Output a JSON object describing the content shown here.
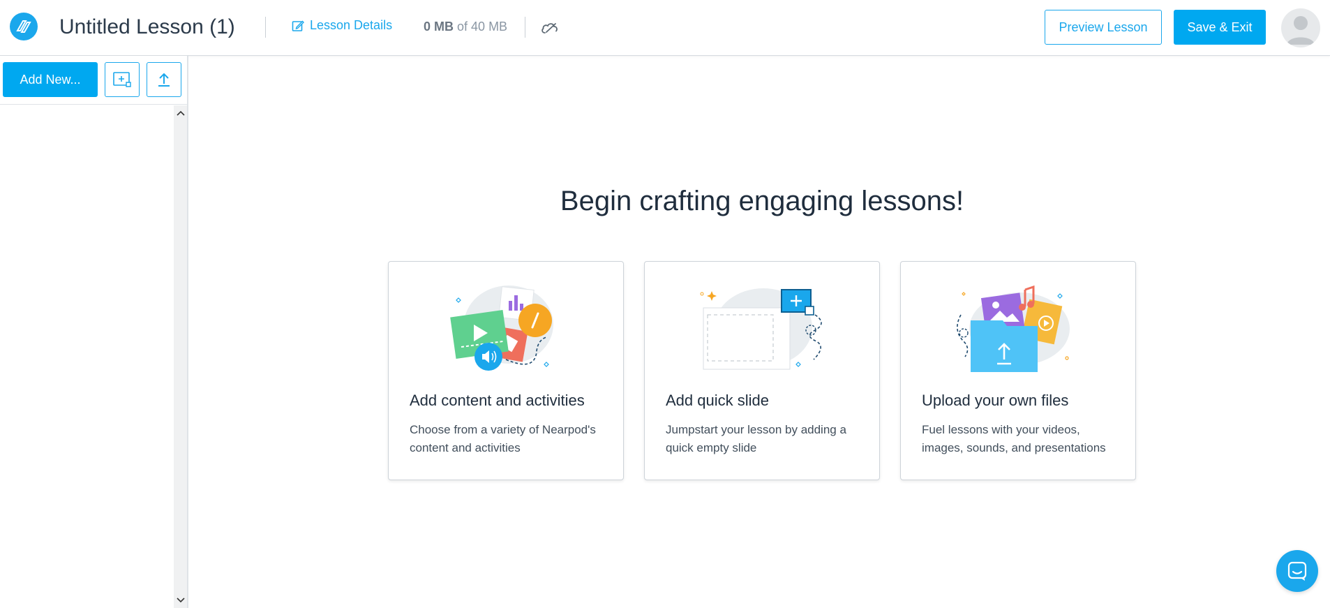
{
  "header": {
    "lesson_title": "Untitled Lesson (1)",
    "lesson_details_label": "Lesson Details",
    "storage_used": "0 MB",
    "storage_total": "of 40 MB",
    "preview_label": "Preview Lesson",
    "save_exit_label": "Save & Exit"
  },
  "sidebar": {
    "add_new_label": "Add New..."
  },
  "main": {
    "heading": "Begin crafting engaging lessons!",
    "cards": [
      {
        "title": "Add content and activities",
        "description": "Choose from a variety of Nearpod's content and activities"
      },
      {
        "title": "Add quick slide",
        "description": "Jumpstart your lesson by adding a quick empty slide"
      },
      {
        "title": "Upload your own files",
        "description": "Fuel lessons with your videos, images, sounds, and presentations"
      }
    ]
  },
  "colors": {
    "accent": "#1aa7ec",
    "primary_button": "#00a8f0",
    "text_dark": "#1f2d3d"
  },
  "icons": [
    "nearpod-logo-icon",
    "edit-icon",
    "cloud-sync-icon",
    "avatar-icon",
    "add-slide-icon",
    "upload-icon",
    "chevron-up-icon",
    "chevron-down-icon",
    "chat-icon"
  ]
}
